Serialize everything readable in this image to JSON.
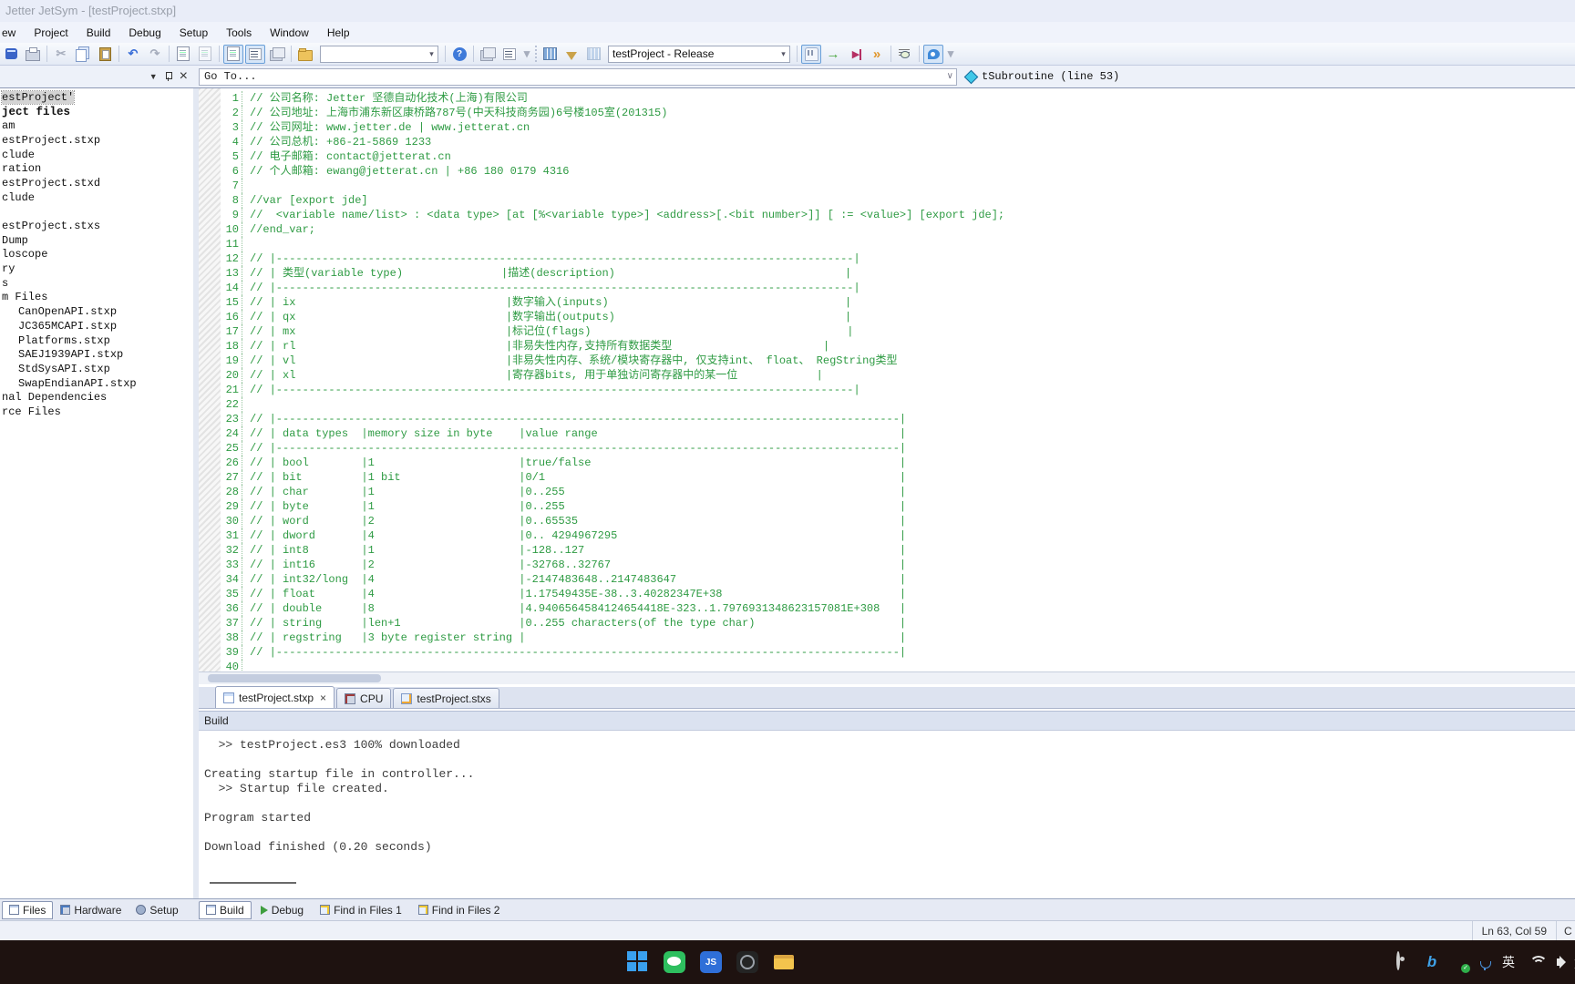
{
  "window": {
    "title": "Jetter JetSym - [testProject.stxp]"
  },
  "menu": {
    "items": [
      "ew",
      "Project",
      "Build",
      "Debug",
      "Setup",
      "Tools",
      "Window",
      "Help"
    ]
  },
  "toolbar": {
    "build_config": "testProject - Release",
    "search_value": ""
  },
  "icons": {
    "undo": "↶",
    "redo": "↷",
    "cut": "✂",
    "help": "?",
    "dropdown": "▾",
    "close": "×",
    "start": "→",
    "stop": "▶",
    "step": "»",
    "overflow": "▾",
    "panel_menu": "▼",
    "combo_arrow": "∨",
    "check": "✓"
  },
  "goto_bar": {
    "value": "Go To...",
    "function": "tSubroutine (line 53)"
  },
  "sidebar": {
    "tree": [
      {
        "label": "estProject'",
        "indent": 0,
        "selected": true,
        "bold": false
      },
      {
        "label": "ject files",
        "indent": 0,
        "selected": false,
        "bold": true
      },
      {
        "label": "am",
        "indent": 0,
        "selected": false,
        "bold": false
      },
      {
        "label": "estProject.stxp",
        "indent": 0,
        "selected": false,
        "bold": false
      },
      {
        "label": "clude",
        "indent": 0,
        "selected": false,
        "bold": false
      },
      {
        "label": "ration",
        "indent": 0,
        "selected": false,
        "bold": false
      },
      {
        "label": "estProject.stxd",
        "indent": 0,
        "selected": false,
        "bold": false
      },
      {
        "label": "clude",
        "indent": 0,
        "selected": false,
        "bold": false
      },
      {
        "label": "",
        "indent": 0,
        "selected": false,
        "bold": false
      },
      {
        "label": "estProject.stxs",
        "indent": 0,
        "selected": false,
        "bold": false
      },
      {
        "label": "Dump",
        "indent": 0,
        "selected": false,
        "bold": false
      },
      {
        "label": "loscope",
        "indent": 0,
        "selected": false,
        "bold": false
      },
      {
        "label": "ry",
        "indent": 0,
        "selected": false,
        "bold": false
      },
      {
        "label": "s",
        "indent": 0,
        "selected": false,
        "bold": false
      },
      {
        "label": "m Files",
        "indent": 0,
        "selected": false,
        "bold": false
      },
      {
        "label": "CanOpenAPI.stxp",
        "indent": 1,
        "selected": false,
        "bold": false
      },
      {
        "label": "JC365MCAPI.stxp",
        "indent": 1,
        "selected": false,
        "bold": false
      },
      {
        "label": "Platforms.stxp",
        "indent": 1,
        "selected": false,
        "bold": false
      },
      {
        "label": "SAEJ1939API.stxp",
        "indent": 1,
        "selected": false,
        "bold": false
      },
      {
        "label": "StdSysAPI.stxp",
        "indent": 1,
        "selected": false,
        "bold": false
      },
      {
        "label": "SwapEndianAPI.stxp",
        "indent": 1,
        "selected": false,
        "bold": false
      },
      {
        "label": "nal Dependencies",
        "indent": 0,
        "selected": false,
        "bold": false
      },
      {
        "label": "rce Files",
        "indent": 0,
        "selected": false,
        "bold": false
      }
    ],
    "tabs": [
      "Files",
      "Hardware",
      "Setup"
    ]
  },
  "editor": {
    "lines": [
      "// 公司名称: Jetter 坚德自动化技术(上海)有限公司",
      "// 公司地址: 上海市浦东新区康桥路787号(中天科技商务园)6号楼105室(201315)",
      "// 公司网址: www.jetter.de | www.jetterat.cn",
      "// 公司总机: +86-21-5869 1233",
      "// 电子邮箱: contact@jetterat.cn",
      "// 个人邮箱: ewang@jetterat.cn | +86 180 0179 4316",
      "",
      "//var [export jde]",
      "//  <variable name/list> : <data type> [at [%<variable type>] <address>[.<bit number>]] [ := <value>] [export jde];",
      "//end_var;",
      "",
      "// |----------------------------------------------------------------------------------------|",
      "// | 类型(variable type)               |描述(description)                                   |",
      "// |----------------------------------------------------------------------------------------|",
      "// | ix                                |数字输入(inputs)                                    |",
      "// | qx                                |数字输出(outputs)                                   |",
      "// | mx                                |标记位(flags)                                       |",
      "// | rl                                |非易失性内存,支持所有数据类型                       |",
      "// | vl                                |非易失性内存、系统/模块寄存器中, 仅支持int、 float、 RegString类型",
      "// | xl                                |寄存器bits, 用于单独访问寄存器中的某一位            |",
      "// |----------------------------------------------------------------------------------------|",
      "",
      "// |-----------------------------------------------------------------------------------------------|",
      "// | data types  |memory size in byte    |value range                                              |",
      "// |-----------------------------------------------------------------------------------------------|",
      "// | bool        |1                      |true/false                                               |",
      "// | bit         |1 bit                  |0/1                                                      |",
      "// | char        |1                      |0..255                                                   |",
      "// | byte        |1                      |0..255                                                   |",
      "// | word        |2                      |0..65535                                                 |",
      "// | dword       |4                      |0.. 4294967295                                           |",
      "// | int8        |1                      |-128..127                                                |",
      "// | int16       |2                      |-32768..32767                                            |",
      "// | int32/long  |4                      |-2147483648..2147483647                                  |",
      "// | float       |4                      |1.17549435E-38..3.40282347E+38                           |",
      "// | double      |8                      |4.9406564584124654418E-323..1.7976931348623157081E+308   |",
      "// | string      |len+1                  |0..255 characters(of the type char)                      |",
      "// | regstring   |3 byte register string |                                                         |",
      "// |-----------------------------------------------------------------------------------------------|",
      ""
    ],
    "tabs": [
      {
        "label": "testProject.stxp",
        "icon": "page",
        "closable": true,
        "active": true
      },
      {
        "label": "CPU",
        "icon": "chip",
        "closable": false,
        "active": false
      },
      {
        "label": "testProject.stxs",
        "icon": "gearpage",
        "closable": false,
        "active": false
      }
    ]
  },
  "build_panel": {
    "title": "Build",
    "lines": [
      "  >> testProject.es3 100% downloaded",
      "",
      "Creating startup file in controller...",
      "  >> Startup file created.",
      "",
      "Program started",
      "",
      "Download finished (0.20 seconds)"
    ]
  },
  "bottom_tabs": [
    {
      "label": "Build",
      "icon": "doc",
      "active": true
    },
    {
      "label": "Debug",
      "icon": "play",
      "active": false
    },
    {
      "label": "Find in Files 1",
      "icon": "find",
      "active": false
    },
    {
      "label": "Find in Files 2",
      "icon": "find",
      "active": false
    }
  ],
  "status_bar": {
    "position": "Ln 63, Col 59",
    "extra": "C"
  },
  "taskbar": {
    "js_label": "JS",
    "ime": "英"
  },
  "colors": {
    "code_green": "#2e9b43",
    "taskbar_bg": "#1e1210",
    "chrome_bg": "#e9edf8",
    "selection_gray": "#d4d4d4",
    "accent_blue": "#3a6fd8"
  }
}
